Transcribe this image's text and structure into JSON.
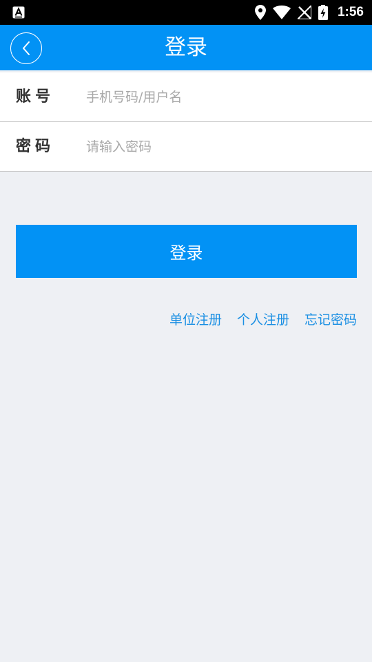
{
  "status_bar": {
    "time": "1:56",
    "left_icon": "a-keyboard-notification-icon",
    "icons": [
      "location-pin-icon",
      "wifi-icon",
      "no-signal-icon",
      "battery-charging-icon"
    ]
  },
  "header": {
    "title": "登录",
    "back_icon": "chevron-left-icon"
  },
  "form": {
    "account_label": "账号",
    "account_placeholder": "手机号码/用户名",
    "account_value": "",
    "password_label": "密码",
    "password_placeholder": "请输入密码",
    "password_value": ""
  },
  "actions": {
    "login_label": "登录",
    "links": {
      "org_register": "单位注册",
      "personal_register": "个人注册",
      "forgot_password": "忘记密码"
    }
  },
  "colors": {
    "accent": "#0292f5",
    "link": "#1a8fe3",
    "background": "#eef0f4"
  }
}
